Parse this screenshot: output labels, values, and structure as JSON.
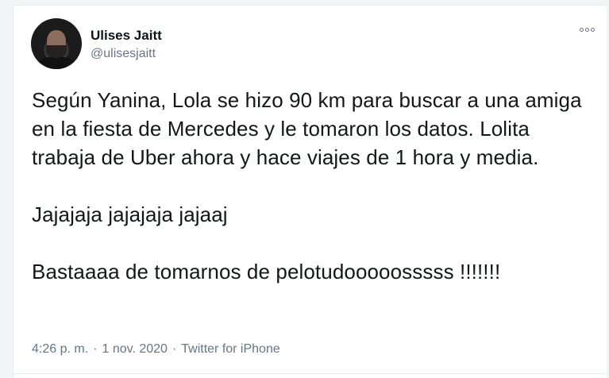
{
  "tweet": {
    "author": {
      "display_name": "Ulises Jaitt",
      "handle": "@ulisesjaitt"
    },
    "paragraphs": [
      "Según Yanina, Lola se hizo 90 km para buscar a una amiga en la fiesta de Mercedes y le tomaron los datos. Lolita trabaja de Uber ahora y hace viajes de 1 hora y media.",
      "Jajajaja jajajaja jajaaj",
      "Bastaaaa de tomarnos de pelotudooooosssss !!!!!!!"
    ],
    "meta": {
      "time": "4:26 p. m.",
      "date": "1 nov. 2020",
      "source": "Twitter for iPhone",
      "separator": "·"
    },
    "icons": {
      "more": "more-icon",
      "avatar": "profile-photo"
    }
  }
}
